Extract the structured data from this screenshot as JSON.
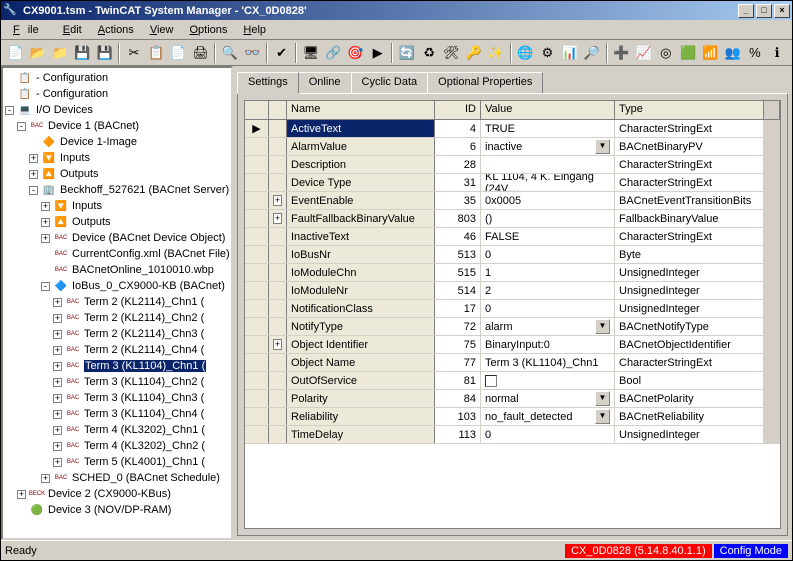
{
  "title": "CX9001.tsm - TwinCAT System Manager - 'CX_0D0828'",
  "menu": {
    "file": "File",
    "edit": "Edit",
    "actions": "Actions",
    "view": "View",
    "options": "Options",
    "help": "Help"
  },
  "tree": {
    "n0": "- Configuration",
    "n1": "- Configuration",
    "n2": "I/O Devices",
    "n3": "Device 1 (BACnet)",
    "n4": "Device 1-Image",
    "n5": "Inputs",
    "n6": "Outputs",
    "n7": "Beckhoff_527621 (BACnet Server)",
    "n8": "Inputs",
    "n9": "Outputs",
    "n10": "Device (BACnet Device Object)",
    "n11": "CurrentConfig.xml (BACnet File)",
    "n12": "BACnetOnline_1010010.wbp",
    "n13": "IoBus_0_CX9000-KB (BACnet)",
    "n14": "Term 2 (KL2114)_Chn1 (",
    "n15": "Term 2 (KL2114)_Chn2 (",
    "n16": "Term 2 (KL2114)_Chn3 (",
    "n17": "Term 2 (KL2114)_Chn4 (",
    "n18": "Term 3 (KL1104)_Chn1 (",
    "n19": "Term 3 (KL1104)_Chn2 (",
    "n20": "Term 3 (KL1104)_Chn3 (",
    "n21": "Term 3 (KL1104)_Chn4 (",
    "n22": "Term 4 (KL3202)_Chn1 (",
    "n23": "Term 4 (KL3202)_Chn2 (",
    "n24": "Term 5 (KL4001)_Chn1 (",
    "n25": "SCHED_0 (BACnet Schedule)",
    "n26": "Device 2 (CX9000-KBus)",
    "n27": "Device 3 (NOV/DP-RAM)"
  },
  "tabs": {
    "settings": "Settings",
    "online": "Online",
    "cyclic": "Cyclic Data",
    "optional": "Optional Properties"
  },
  "gridHead": {
    "name": "Name",
    "id": "ID",
    "value": "Value",
    "type": "Type"
  },
  "rows": [
    {
      "name": "ActiveText",
      "id": "4",
      "value": "TRUE",
      "type": "CharacterStringExt",
      "sel": true,
      "mark": "▶"
    },
    {
      "name": "AlarmValue",
      "id": "6",
      "value": "inactive",
      "type": "BACnetBinaryPV",
      "dd": true
    },
    {
      "name": "Description",
      "id": "28",
      "value": "",
      "type": "CharacterStringExt"
    },
    {
      "name": "Device Type",
      "id": "31",
      "value": "KL 1104, 4 K. Eingang (24V…",
      "type": "CharacterStringExt"
    },
    {
      "name": "EventEnable",
      "id": "35",
      "value": "0x0005",
      "type": "BACnetEventTransitionBits",
      "exp": "+"
    },
    {
      "name": "FaultFallbackBinaryValue",
      "id": "803",
      "value": "()",
      "type": "FallbackBinaryValue",
      "exp": "+"
    },
    {
      "name": "InactiveText",
      "id": "46",
      "value": "FALSE",
      "type": "CharacterStringExt"
    },
    {
      "name": "IoBusNr",
      "id": "513",
      "value": "0",
      "type": "Byte"
    },
    {
      "name": "IoModuleChn",
      "id": "515",
      "value": "1",
      "type": "UnsignedInteger"
    },
    {
      "name": "IoModuleNr",
      "id": "514",
      "value": "2",
      "type": "UnsignedInteger"
    },
    {
      "name": "NotificationClass",
      "id": "17",
      "value": "0",
      "type": "UnsignedInteger"
    },
    {
      "name": "NotifyType",
      "id": "72",
      "value": "alarm",
      "type": "BACnetNotifyType",
      "dd": true
    },
    {
      "name": "Object Identifier",
      "id": "75",
      "value": "BinaryInput:0",
      "type": "BACnetObjectIdentifier",
      "exp": "+"
    },
    {
      "name": "Object Name",
      "id": "77",
      "value": "Term 3 (KL1104)_Chn1",
      "type": "CharacterStringExt"
    },
    {
      "name": "OutOfService",
      "id": "81",
      "value": "",
      "type": "Bool",
      "chk": true
    },
    {
      "name": "Polarity",
      "id": "84",
      "value": "normal",
      "type": "BACnetPolarity",
      "dd": true
    },
    {
      "name": "Reliability",
      "id": "103",
      "value": "no_fault_detected",
      "type": "BACnetReliability",
      "dd": true
    },
    {
      "name": "TimeDelay",
      "id": "113",
      "value": "0",
      "type": "UnsignedInteger"
    }
  ],
  "status": {
    "ready": "Ready",
    "server": "CX_0D0828 (5.14.8.40.1.1)",
    "mode": "Config Mode"
  }
}
